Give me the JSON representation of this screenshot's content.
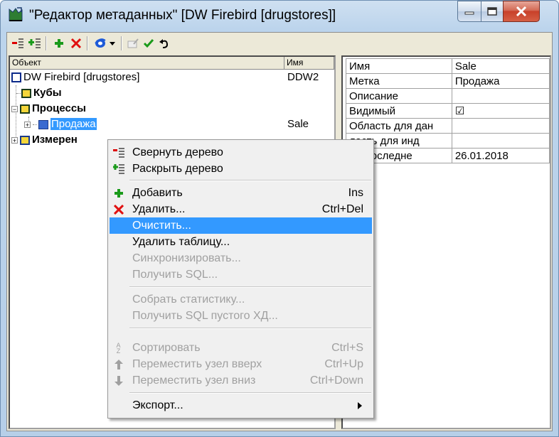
{
  "window": {
    "title": "\"Редактор метаданных\" [DW Firebird [drugstores]]",
    "accent": "#3399ff"
  },
  "tree": {
    "headers": [
      "Объект",
      "Имя"
    ],
    "rows": [
      {
        "label": "DW Firebird [drugstores]",
        "name": "DDW2"
      },
      {
        "label": "Кубы",
        "name": ""
      },
      {
        "label": "Процессы",
        "name": ""
      },
      {
        "label": "Продажа",
        "name": "Sale"
      },
      {
        "label": "Измерен",
        "name": ""
      }
    ]
  },
  "properties": [
    {
      "key": "Имя",
      "value": "Sale"
    },
    {
      "key": "Метка",
      "value": "Продажа"
    },
    {
      "key": "Описание",
      "value": ""
    },
    {
      "key": "Видимый",
      "value": "☑"
    },
    {
      "key": "Область для дан",
      "value": ""
    },
    {
      "key": "ласть для инд",
      "value": ""
    },
    {
      "key": "мя последне",
      "value": "26.01.2018"
    }
  ],
  "context_menu": {
    "collapse": "Свернуть дерево",
    "expand": "Раскрыть дерево",
    "add": "Добавить",
    "add_sc": "Ins",
    "delete": "Удалить...",
    "delete_sc": "Ctrl+Del",
    "clear": "Очистить...",
    "delete_table": "Удалить таблицу...",
    "sync": "Синхронизировать...",
    "get_sql": "Получить SQL...",
    "collect_stats": "Собрать статистику...",
    "get_sql_empty": "Получить SQL пустого ХД...",
    "sort": "Сортировать",
    "sort_sc": "Ctrl+S",
    "move_up": "Переместить узел вверх",
    "move_up_sc": "Ctrl+Up",
    "move_down": "Переместить узел вниз",
    "move_down_sc": "Ctrl+Down",
    "export": "Экспорт..."
  }
}
